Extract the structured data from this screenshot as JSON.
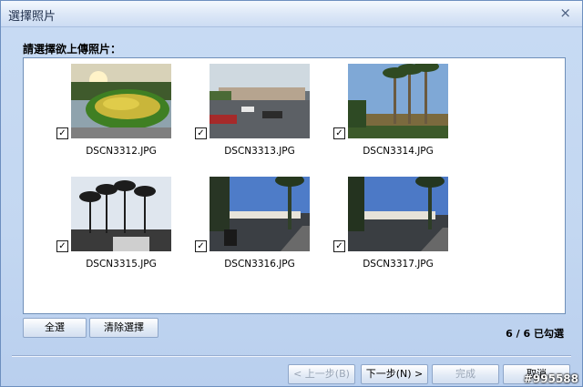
{
  "window": {
    "title": "選擇照片",
    "close_glyph": "×"
  },
  "prompt": "請選擇欲上傳照片：",
  "photos": [
    {
      "filename": "DSCN3312.JPG",
      "checked": true
    },
    {
      "filename": "DSCN3313.JPG",
      "checked": true
    },
    {
      "filename": "DSCN3314.JPG",
      "checked": true
    },
    {
      "filename": "DSCN3315.JPG",
      "checked": true
    },
    {
      "filename": "DSCN3316.JPG",
      "checked": true
    },
    {
      "filename": "DSCN3317.JPG",
      "checked": true
    }
  ],
  "check_glyph": "✓",
  "selection_buttons": {
    "select_all": "全選",
    "clear_selection": "清除選擇"
  },
  "selected_count": "6 / 6 已勾選",
  "footer_buttons": {
    "prev": "< 上一步(B)",
    "next": "下一步(N) >",
    "finish": "完成",
    "cancel": "取消"
  },
  "watermark": "#995588"
}
